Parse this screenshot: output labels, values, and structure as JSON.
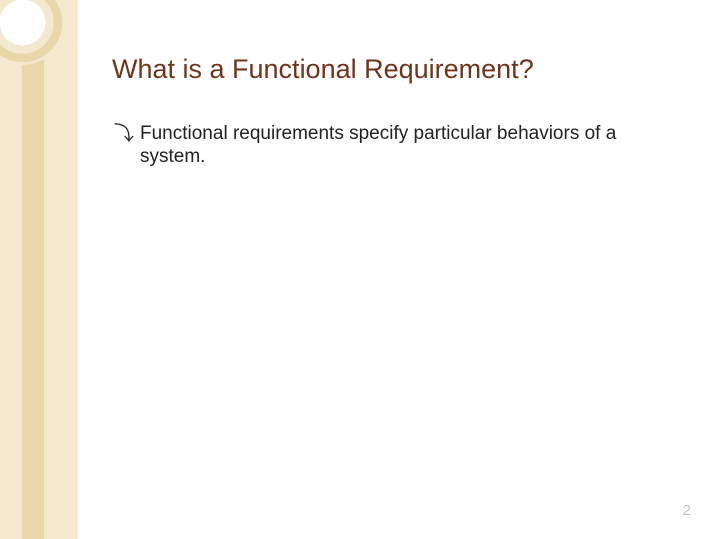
{
  "slide": {
    "title": "What is a Functional Requirement?",
    "bullets": [
      {
        "glyph": "⤵",
        "text": "Functional requirements specify particular behaviors of a system."
      }
    ],
    "pageNumber": "2"
  }
}
